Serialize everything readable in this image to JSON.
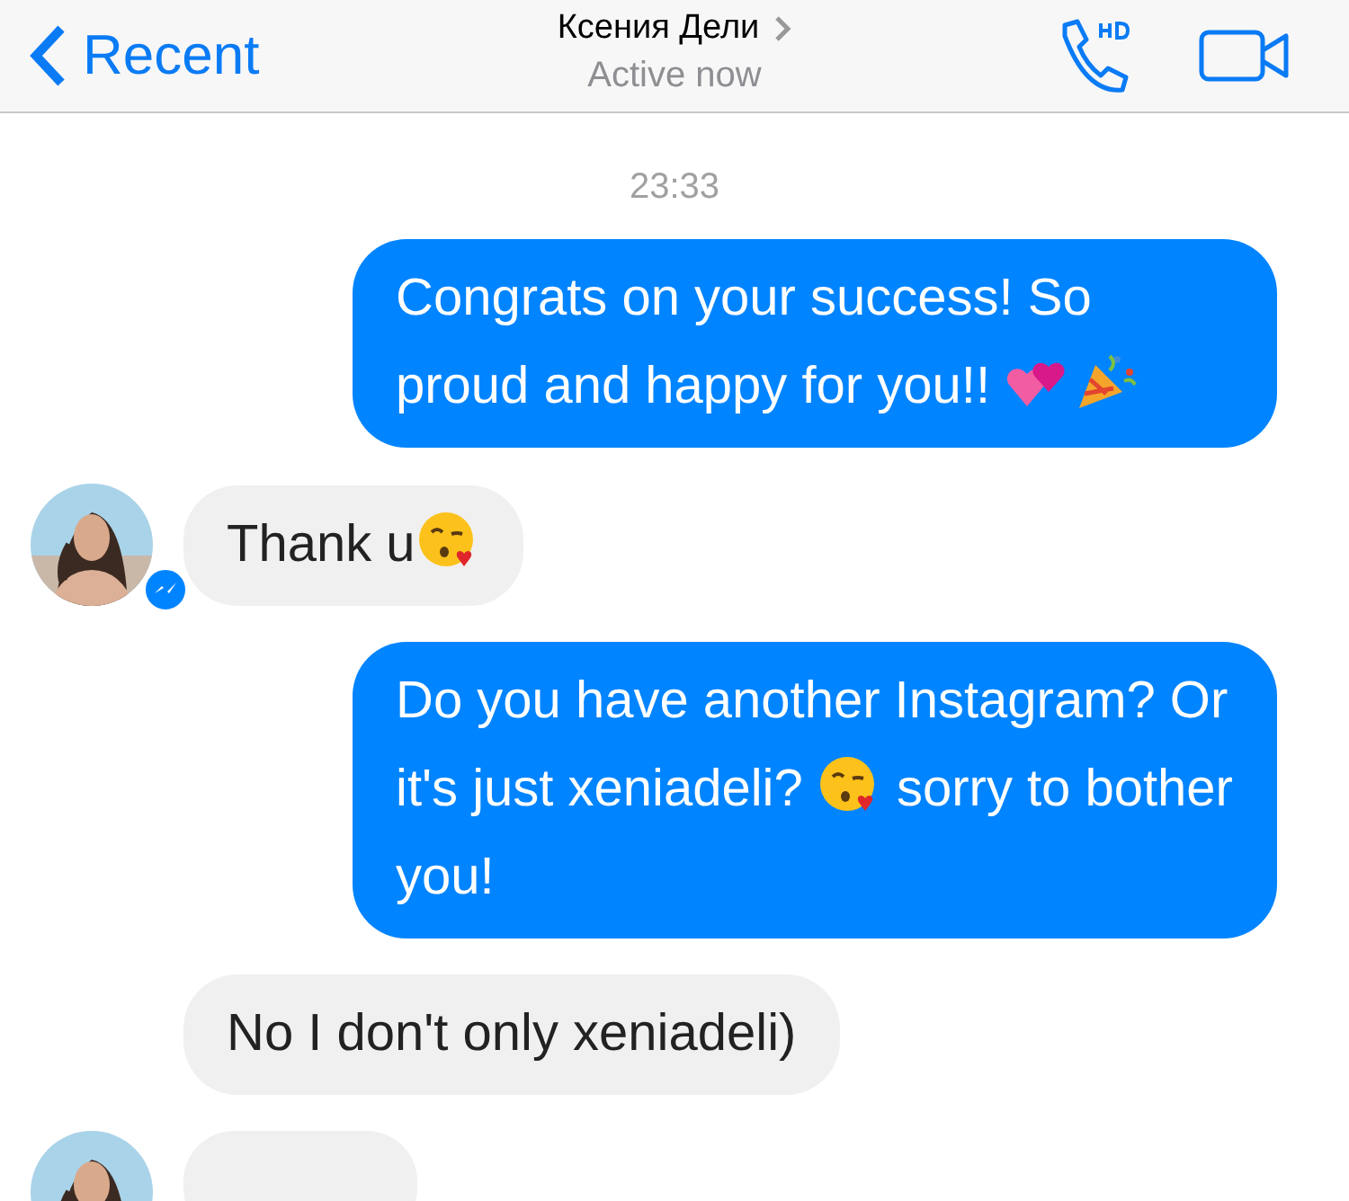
{
  "header": {
    "back_label": "Recent",
    "title": "Ксения Дели",
    "status": "Active now"
  },
  "timestamp": "23:33",
  "messages": [
    {
      "kind": "sent",
      "parts": [
        {
          "kind": "text",
          "text": "Congrats on your success! So proud and happy for you!! "
        },
        {
          "kind": "hearts"
        },
        {
          "kind": "party"
        }
      ]
    },
    {
      "kind": "received",
      "avatar": true,
      "parts": [
        {
          "kind": "text",
          "text": "Thank u"
        },
        {
          "kind": "kiss"
        }
      ]
    },
    {
      "kind": "sent",
      "parts": [
        {
          "kind": "text",
          "text": "Do you have another Instagram? Or it's just xeniadeli? "
        },
        {
          "kind": "kiss"
        },
        {
          "kind": "text",
          "text": " sorry to bother you!"
        }
      ]
    },
    {
      "kind": "received",
      "avatar": false,
      "parts": [
        {
          "kind": "text",
          "text": "No I don't only xeniadeli)"
        }
      ]
    },
    {
      "kind": "cut-off",
      "avatar": true
    }
  ]
}
